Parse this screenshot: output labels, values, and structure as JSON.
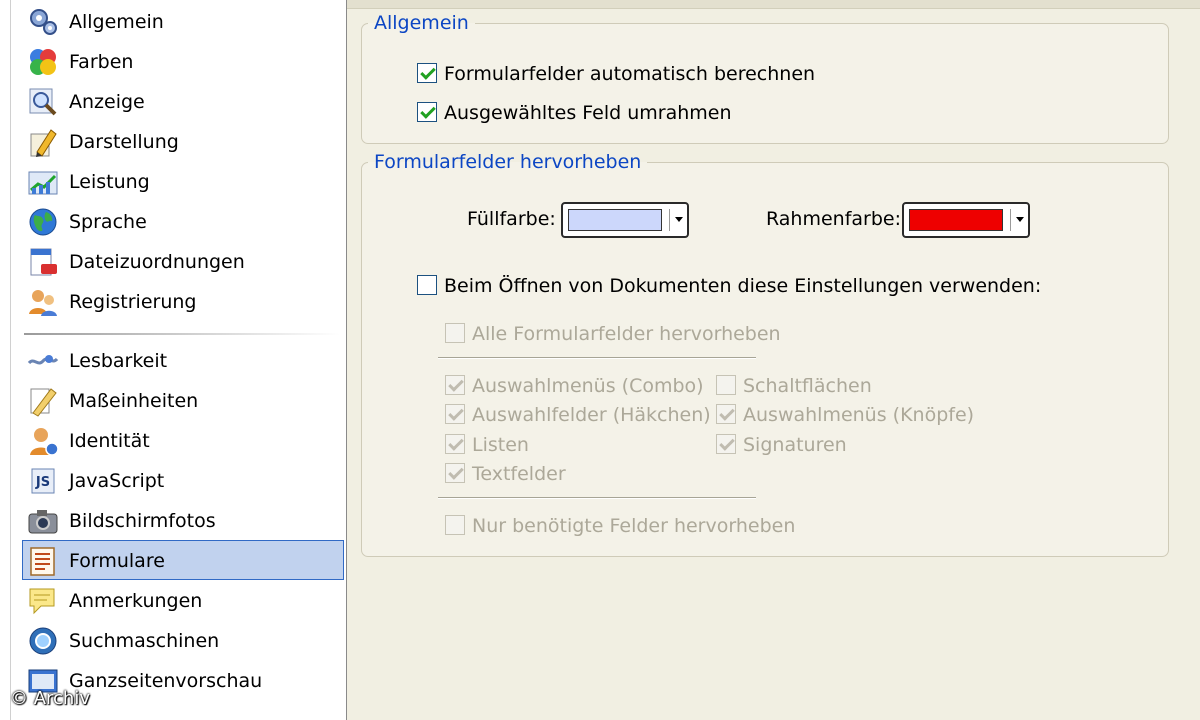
{
  "sidebar": {
    "group1": [
      {
        "label": "Allgemein",
        "icon": "gears-icon"
      },
      {
        "label": "Farben",
        "icon": "color-balls-icon"
      },
      {
        "label": "Anzeige",
        "icon": "magnifier-icon"
      },
      {
        "label": "Darstellung",
        "icon": "paint-pencil-icon"
      },
      {
        "label": "Leistung",
        "icon": "performance-chart-icon"
      },
      {
        "label": "Sprache",
        "icon": "globe-icon"
      },
      {
        "label": "Dateizuordnungen",
        "icon": "file-association-icon"
      },
      {
        "label": "Registrierung",
        "icon": "users-icon"
      }
    ],
    "group2": [
      {
        "label": "Lesbarkeit",
        "icon": "accessibility-icon"
      },
      {
        "label": "Maßeinheiten",
        "icon": "ruler-icon"
      },
      {
        "label": "Identität",
        "icon": "identity-icon"
      },
      {
        "label": "JavaScript",
        "icon": "javascript-icon"
      },
      {
        "label": "Bildschirmfotos",
        "icon": "camera-icon"
      },
      {
        "label": "Formulare",
        "icon": "form-icon",
        "selected": true
      },
      {
        "label": "Anmerkungen",
        "icon": "note-icon"
      },
      {
        "label": "Suchmaschinen",
        "icon": "search-engine-icon"
      },
      {
        "label": "Ganzseitenvorschau",
        "icon": "fullpage-preview-icon"
      }
    ]
  },
  "general": {
    "legend": "Allgemein",
    "auto_calc": {
      "label": "Formularfelder automatisch berechnen",
      "checked": true
    },
    "frame_field": {
      "label": "Ausgewähltes Feld umrahmen",
      "checked": true
    }
  },
  "highlight": {
    "legend": "Formularfelder hervorheben",
    "fill_label": "Füllfarbe:",
    "fill_color": "#ccd7fb",
    "border_label": "Rahmenfarbe:",
    "border_color": "#ee0000",
    "on_open": {
      "label": "Beim Öffnen von Dokumenten diese Einstellungen verwenden:",
      "checked": false
    },
    "all_fields": {
      "label": "Alle Formularfelder hervorheben",
      "checked": false
    },
    "types": {
      "combo": {
        "label": "Auswahlmenüs (Combo)",
        "checked": true
      },
      "buttons": {
        "label": "Schaltflächen",
        "checked": false
      },
      "checkboxes": {
        "label": "Auswahlfelder (Häkchen)",
        "checked": true
      },
      "radios": {
        "label": "Auswahlmenüs (Knöpfe)",
        "checked": true
      },
      "lists": {
        "label": "Listen",
        "checked": true
      },
      "signatures": {
        "label": "Signaturen",
        "checked": true
      },
      "textfields": {
        "label": "Textfelder",
        "checked": true
      }
    },
    "required_only": {
      "label": "Nur benötigte Felder hervorheben",
      "checked": false
    }
  },
  "watermark": "© Archiv"
}
